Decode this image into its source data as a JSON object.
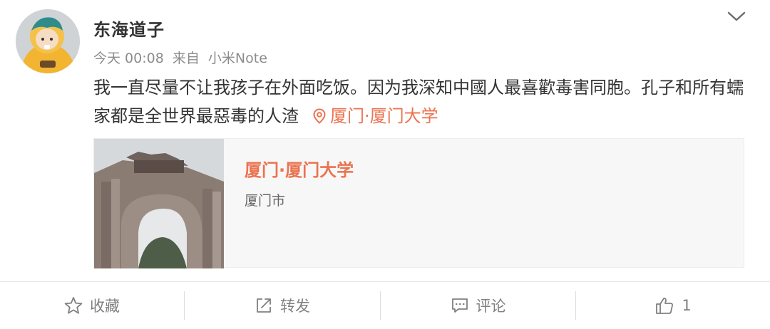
{
  "post": {
    "username": "东海道子",
    "time": "今天 00:08",
    "source_prefix": "来自",
    "source": "小米Note",
    "text": "我一直尽量不让我孩子在外面吃饭。因为我深知中國人最喜歡毒害同胞。孔子和所有蠕家都是全世界最惡毒的人渣",
    "location_tag": "厦门·厦门大学"
  },
  "location_card": {
    "title": "厦门·厦门大学",
    "subtitle": "厦门市"
  },
  "actions": {
    "favorite_label": "收藏",
    "repost_label": "转发",
    "comment_label": "评论",
    "like_count": "1"
  },
  "icons": {
    "menu": "chevron-down-icon",
    "location": "location-pin-icon",
    "favorite": "star-icon",
    "repost": "share-icon",
    "comment": "comment-icon",
    "like": "thumbs-up-icon"
  },
  "colors": {
    "accent": "#eb7350",
    "text": "#333333",
    "muted": "#8c8c8c"
  }
}
